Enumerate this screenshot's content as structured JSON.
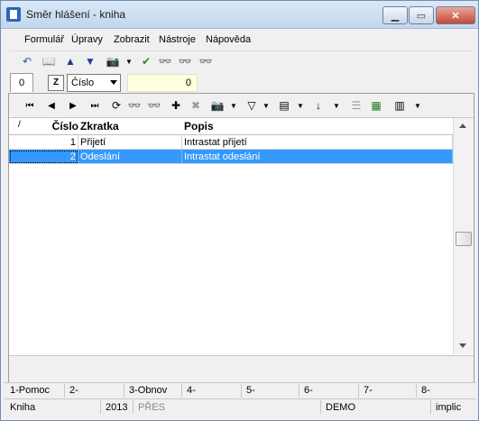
{
  "window": {
    "title": "Směr hlášení - kniha"
  },
  "menu": [
    "Formulář",
    "Úpravy",
    "Zobrazit",
    "Nástroje",
    "Nápověda"
  ],
  "filter": {
    "tab": "0",
    "z_button": "Z",
    "field": "Číslo",
    "value": "0"
  },
  "table": {
    "corner": "/",
    "headers": [
      "Číslo",
      "Zkratka",
      "Popis"
    ],
    "rows": [
      {
        "cislo": "1",
        "zkratka": "Přijetí",
        "popis": "Intrastat přijetí"
      },
      {
        "cislo": "2",
        "zkratka": "Odeslání",
        "popis": "Intrastat odeslání"
      }
    ],
    "selected_row": 2
  },
  "fkeys": [
    "1-Pomoc",
    "2-",
    "3-Obnov",
    "4-",
    "5-",
    "6-",
    "7-",
    "8-"
  ],
  "status": {
    "kniha": "Kniha",
    "year": "2013",
    "mode": "PŘES",
    "db": "DEMO",
    "implic": "implic"
  },
  "colors": {
    "selection": "#3399ff",
    "input_bg": "#ffffe1"
  }
}
